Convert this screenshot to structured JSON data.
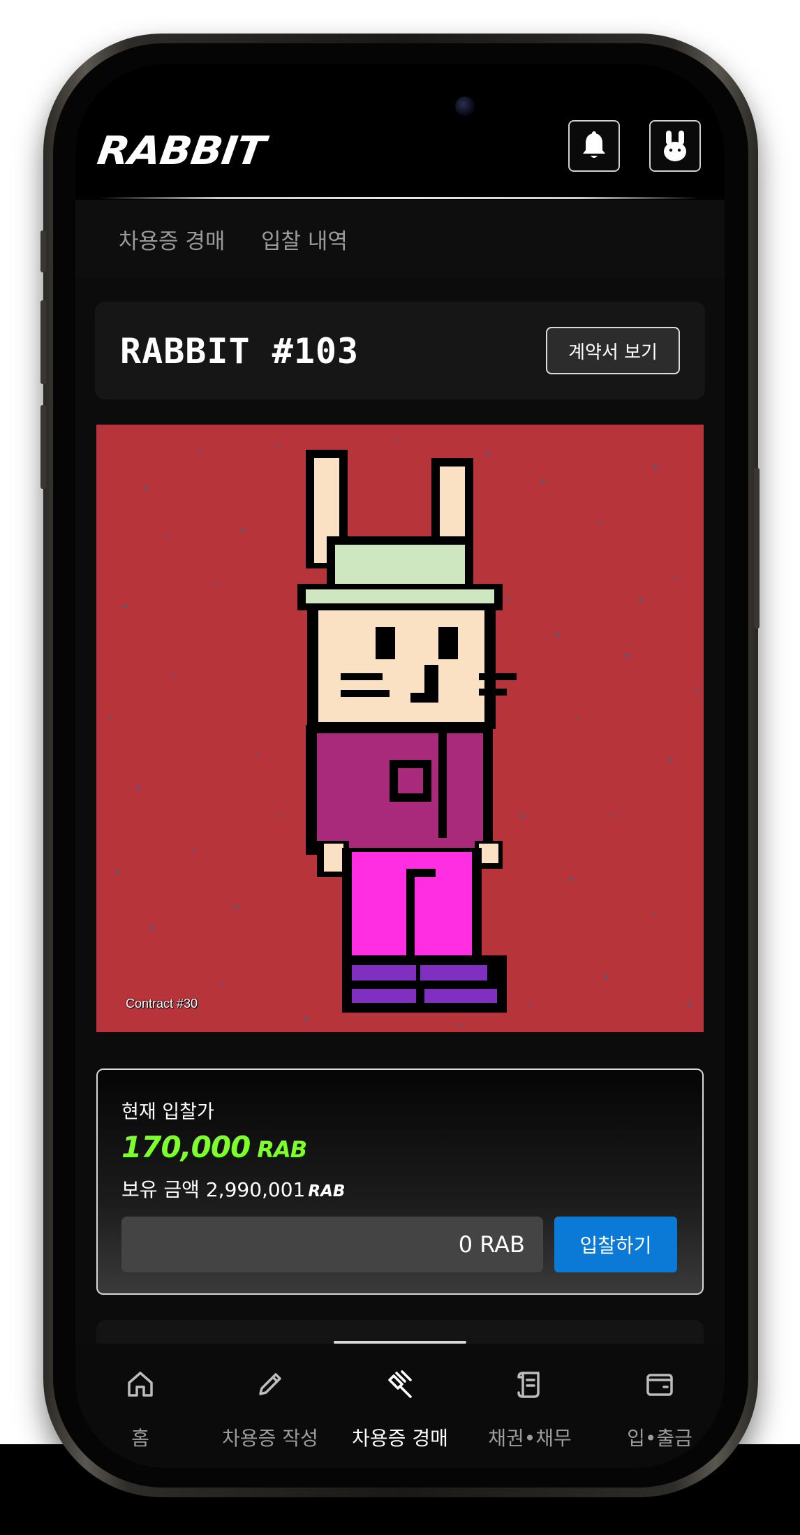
{
  "header": {
    "logo": "RABBIT",
    "bell_icon": "bell-icon",
    "profile_icon": "rabbit-profile-icon"
  },
  "subnav": {
    "items": [
      {
        "label": "차용증 경매"
      },
      {
        "label": "입찰 내역"
      }
    ]
  },
  "auction": {
    "title": "RABBIT #103",
    "contract_button": "계약서 보기",
    "image_caption": "Contract #30",
    "image_bg_color": "#b7343a"
  },
  "bid": {
    "label": "현재 입찰가",
    "current_price": "170,000",
    "price_unit": "RAB",
    "balance_label": "보유 금액",
    "balance_value": "2,990,001",
    "balance_unit": "RAB",
    "input_value": "0 RAB",
    "submit_label": "입찰하기",
    "accent_color": "#7cff2c",
    "button_color": "#0a7ad6"
  },
  "tabbar": {
    "active_index": 2,
    "tabs": [
      {
        "label": "홈",
        "icon": "home-icon"
      },
      {
        "label": "차용증 작성",
        "icon": "pencil-icon"
      },
      {
        "label": "차용증 경매",
        "icon": "gavel-icon"
      },
      {
        "label": "채권•채무",
        "icon": "scroll-icon"
      },
      {
        "label": "입•출금",
        "icon": "wallet-icon"
      }
    ]
  }
}
